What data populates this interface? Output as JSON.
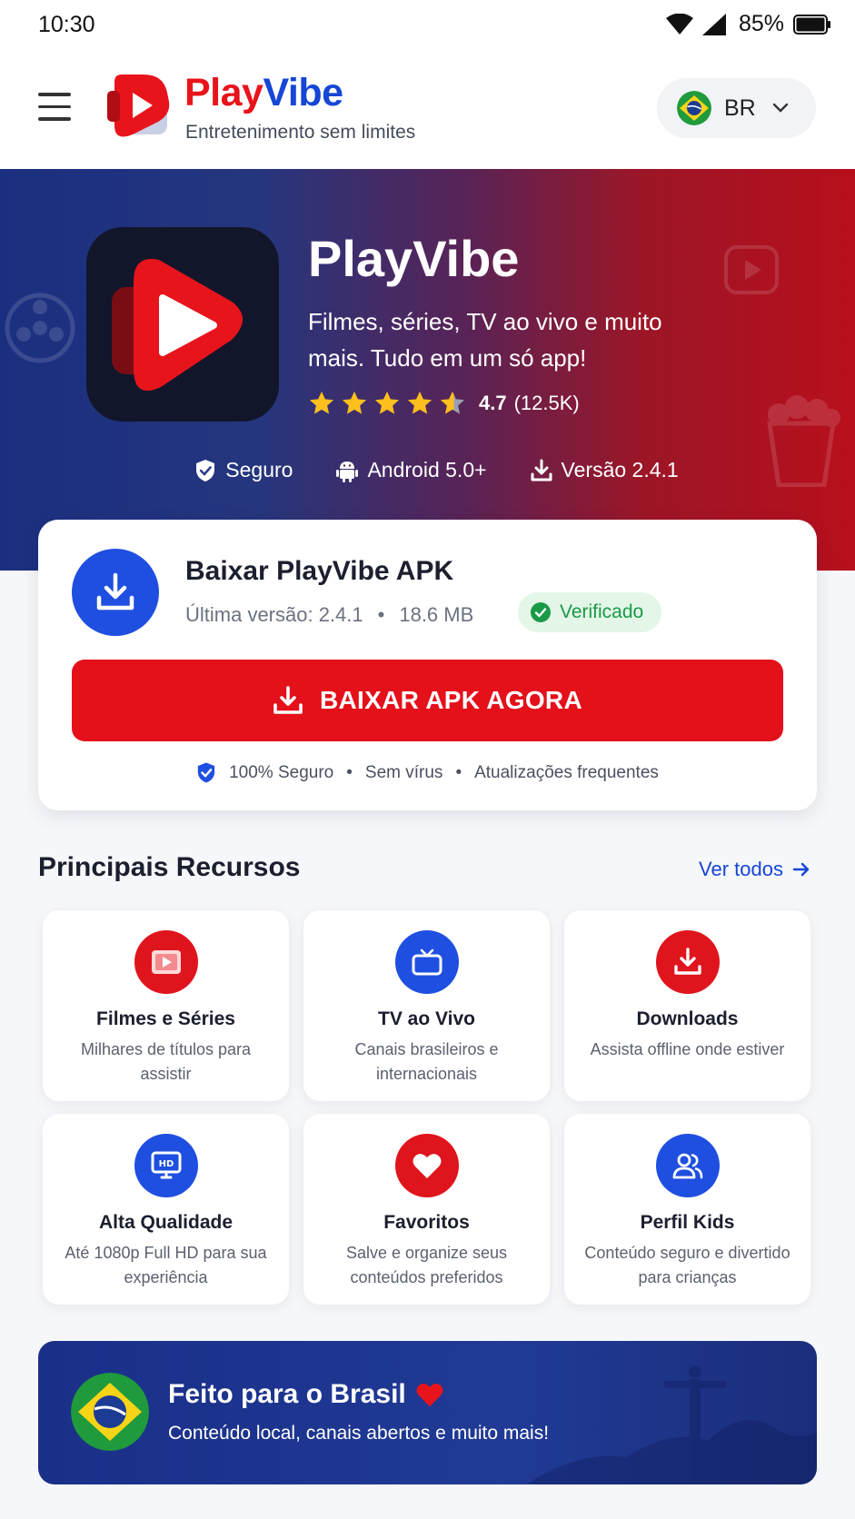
{
  "status_bar": {
    "time": "10:30",
    "battery": "85%"
  },
  "header": {
    "brand_part1": "Play",
    "brand_part2": "Vibe",
    "tagline": "Entretenimento sem limites",
    "language_code": "BR"
  },
  "hero": {
    "title": "PlayVibe",
    "description": "Filmes, séries, TV ao vivo e muito mais. Tudo em um só app!",
    "rating_value": 4.7,
    "rating_score": "4.7",
    "rating_count": "(12.5K)",
    "badges": [
      {
        "label": "Seguro",
        "icon": "shield-check-icon"
      },
      {
        "label": "Android 5.0+",
        "icon": "android-icon"
      },
      {
        "label": "Versão 2.4.1",
        "icon": "download-icon"
      }
    ]
  },
  "download_card": {
    "title": "Baixar PlayVibe APK",
    "version": "Última versão: 2.4.1",
    "separator": "•",
    "size": "18.6 MB",
    "verified_label": "Verificado",
    "button_label": "BAIXAR APK AGORA",
    "footer": [
      "100% Seguro",
      "Sem vírus",
      "Atualizações frequentes"
    ]
  },
  "features": {
    "title": "Principais Recursos",
    "see_all": "Ver todos",
    "items": [
      {
        "title": "Filmes e Séries",
        "desc": "Milhares de títulos para assistir",
        "icon": "film-icon",
        "color": "#e0141c"
      },
      {
        "title": "TV ao Vivo",
        "desc": "Canais brasileiros e internacionais",
        "icon": "tv-icon",
        "color": "#1f4fe0"
      },
      {
        "title": "Downloads",
        "desc": "Assista offline onde estiver",
        "icon": "download-icon",
        "color": "#e0141c"
      },
      {
        "title": "Alta Qualidade",
        "desc": "Até 1080p Full HD para sua experiência",
        "icon": "hd-monitor-icon",
        "color": "#1f4fe0"
      },
      {
        "title": "Favoritos",
        "desc": "Salve e organize seus conteúdos preferidos",
        "icon": "heart-icon",
        "color": "#e0141c"
      },
      {
        "title": "Perfil Kids",
        "desc": "Conteúdo seguro e divertido para crianças",
        "icon": "users-icon",
        "color": "#1f4fe0"
      }
    ]
  },
  "banner": {
    "title": "Feito para o Brasil",
    "subtitle": "Conteúdo local, canais abertos e muito mais!"
  },
  "colors": {
    "brand_red": "#e4101a",
    "brand_blue": "#1546d6",
    "verified_green": "#1a9a46"
  }
}
